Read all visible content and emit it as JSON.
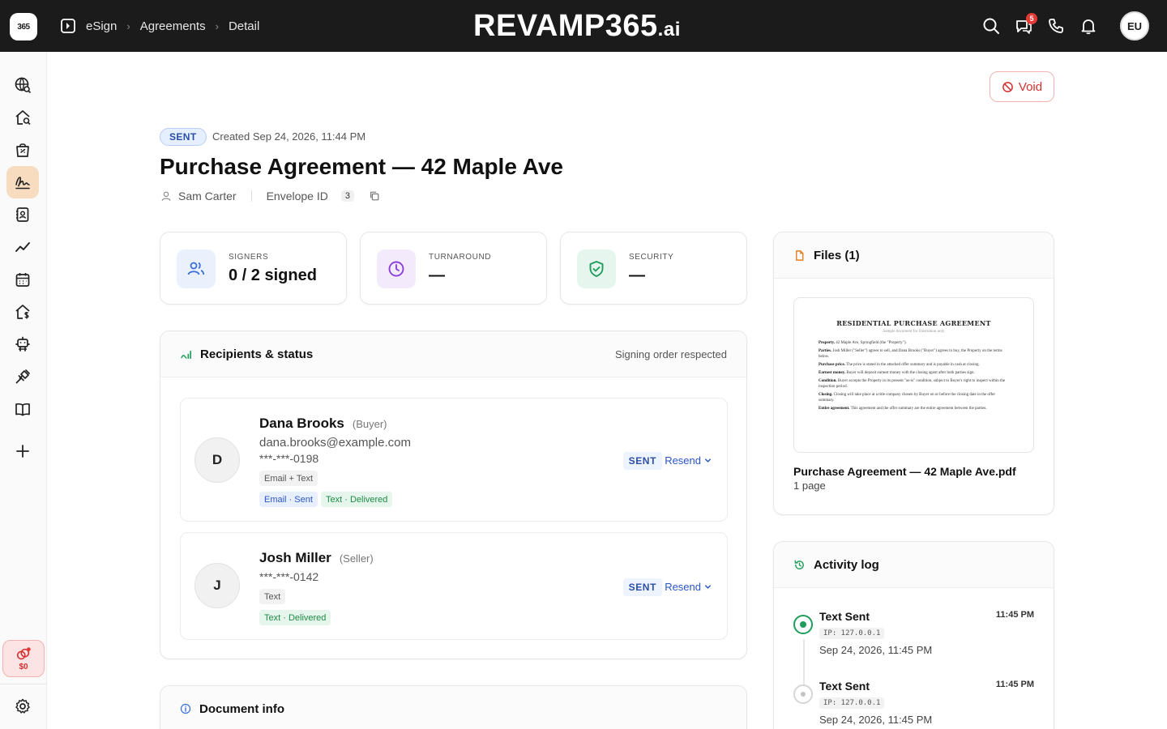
{
  "topbar": {
    "logo_text": "365",
    "breadcrumbs": [
      "eSign",
      "Agreements",
      "Detail"
    ],
    "brand": "REVAMP365",
    "brand_suffix": ".ai",
    "notification_count": "5",
    "user_initials": "EU",
    "icons": [
      "search-icon",
      "chat-icon",
      "phone-icon",
      "bell-icon"
    ]
  },
  "sidebar": {
    "items": [
      "globe-search-icon",
      "home-search-icon",
      "bag-icon",
      "signature-icon",
      "contacts-icon",
      "chart-line-icon",
      "calendar-icon",
      "home-dollar-icon",
      "robot-icon",
      "plug-icon",
      "book-icon",
      "plus-icon"
    ],
    "active_index": 3,
    "wallet_amount": "$0"
  },
  "header": {
    "status": "SENT",
    "created": "Created Sep 24, 2026, 11:44 PM",
    "title": "Purchase Agreement — 42 Maple Ave",
    "owner": "Sam Carter",
    "envelope_label": "Envelope ID",
    "envelope_value": "3",
    "void_label": "Void"
  },
  "stats": [
    {
      "label": "SIGNERS",
      "value": "0 / 2 signed",
      "icon": "users-icon",
      "color": "#3b6fd8"
    },
    {
      "label": "TURNAROUND",
      "value": "—",
      "icon": "clock-icon",
      "color": "#8b3fd6"
    },
    {
      "label": "SECURITY",
      "value": "—",
      "icon": "shield-check-icon",
      "color": "#1f9d5c"
    }
  ],
  "recipients": {
    "title": "Recipients & status",
    "order_note": "Signing order respected",
    "items": [
      {
        "initial": "D",
        "name": "Dana Brooks",
        "role": "(Buyer)",
        "email": "dana.brooks@example.com",
        "phone": "***-***-0198",
        "delivery": "Email + Text",
        "chips": [
          {
            "text": "Email · Sent",
            "tone": "blue"
          },
          {
            "text": "Text · Delivered",
            "tone": "green"
          }
        ],
        "status": "SENT",
        "action": "Resend"
      },
      {
        "initial": "J",
        "name": "Josh Miller",
        "role": "(Seller)",
        "email": "",
        "phone": "***-***-0142",
        "delivery": "Text",
        "chips": [
          {
            "text": "Text · Delivered",
            "tone": "green"
          }
        ],
        "status": "SENT",
        "action": "Resend"
      }
    ]
  },
  "document_info": {
    "title": "Document info"
  },
  "files": {
    "title": "Files (1)",
    "preview": {
      "heading": "RESIDENTIAL PURCHASE AGREEMENT",
      "subheading": "Sample document for illustration only",
      "clauses": [
        {
          "term": "Property.",
          "text": "42 Maple Ave, Springfield (the \"Property\")."
        },
        {
          "term": "Parties.",
          "text": "Josh Miller (\"Seller\") agrees to sell, and Dana Brooks (\"Buyer\") agrees to buy, the Property on the terms below."
        },
        {
          "term": "Purchase price.",
          "text": "The price is stated in the attached offer summary and is payable in cash at closing."
        },
        {
          "term": "Earnest money.",
          "text": "Buyer will deposit earnest money with the closing agent after both parties sign."
        },
        {
          "term": "Condition.",
          "text": "Buyer accepts the Property in its present \"as-is\" condition, subject to Buyer's right to inspect within the inspection period."
        },
        {
          "term": "Closing.",
          "text": "Closing will take place at a title company chosen by Buyer on or before the closing date in the offer summary."
        },
        {
          "term": "Entire agreement.",
          "text": "This agreement and the offer summary are the entire agreement between the parties."
        }
      ]
    },
    "file_name": "Purchase Agreement — 42 Maple Ave.pdf",
    "file_pages": "1 page"
  },
  "activity": {
    "title": "Activity log",
    "items": [
      {
        "title": "Text Sent",
        "time": "11:45 PM",
        "ip": "IP: 127.0.0.1",
        "date": "Sep 24, 2026, 11:45 PM",
        "current": true
      },
      {
        "title": "Text Sent",
        "time": "11:45 PM",
        "ip": "IP: 127.0.0.1",
        "date": "Sep 24, 2026, 11:45 PM",
        "current": false
      }
    ]
  }
}
